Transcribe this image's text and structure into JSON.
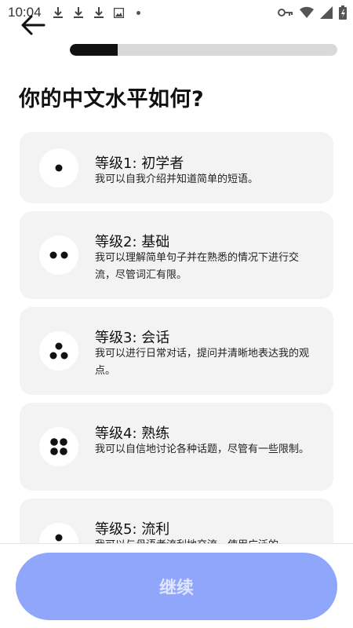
{
  "status_bar": {
    "time": "10:04",
    "left_icons": [
      "download-icon",
      "download-icon",
      "download-icon",
      "image-icon",
      "dot-icon"
    ],
    "right_icons": [
      "key-icon",
      "wifi-icon",
      "signal-icon",
      "battery-icon"
    ]
  },
  "header": {
    "back_icon": "arrow-left-icon",
    "progress_fraction": 0.18
  },
  "page": {
    "title": "你的中文水平如何?"
  },
  "levels": [
    {
      "title": "等级1: 初学者",
      "description": "我可以自我介绍并知道简单的短语。",
      "icon": "one-dot-icon"
    },
    {
      "title": "等级2: 基础",
      "description": "我可以理解简单句子并在熟悉的情况下进行交流，尽管词汇有限。",
      "icon": "two-dots-icon"
    },
    {
      "title": "等级3: 会话",
      "description": "我可以进行日常对话，提问并清晰地表达我的观点。",
      "icon": "three-dots-icon"
    },
    {
      "title": "等级4: 熟练",
      "description": "我可以自信地讨论各种话题，尽管有一些限制。",
      "icon": "four-dots-icon"
    },
    {
      "title": "等级5: 流利",
      "description": "我可以与母语者流利地交流，使用广泛的",
      "icon": "three-dots-icon"
    }
  ],
  "footer": {
    "continue_label": "继续"
  },
  "colors": {
    "accent_button": "#8fa6fb",
    "card_bg": "#f3f3f3",
    "progress_fill": "#111111",
    "progress_track": "#d9d9d9"
  }
}
